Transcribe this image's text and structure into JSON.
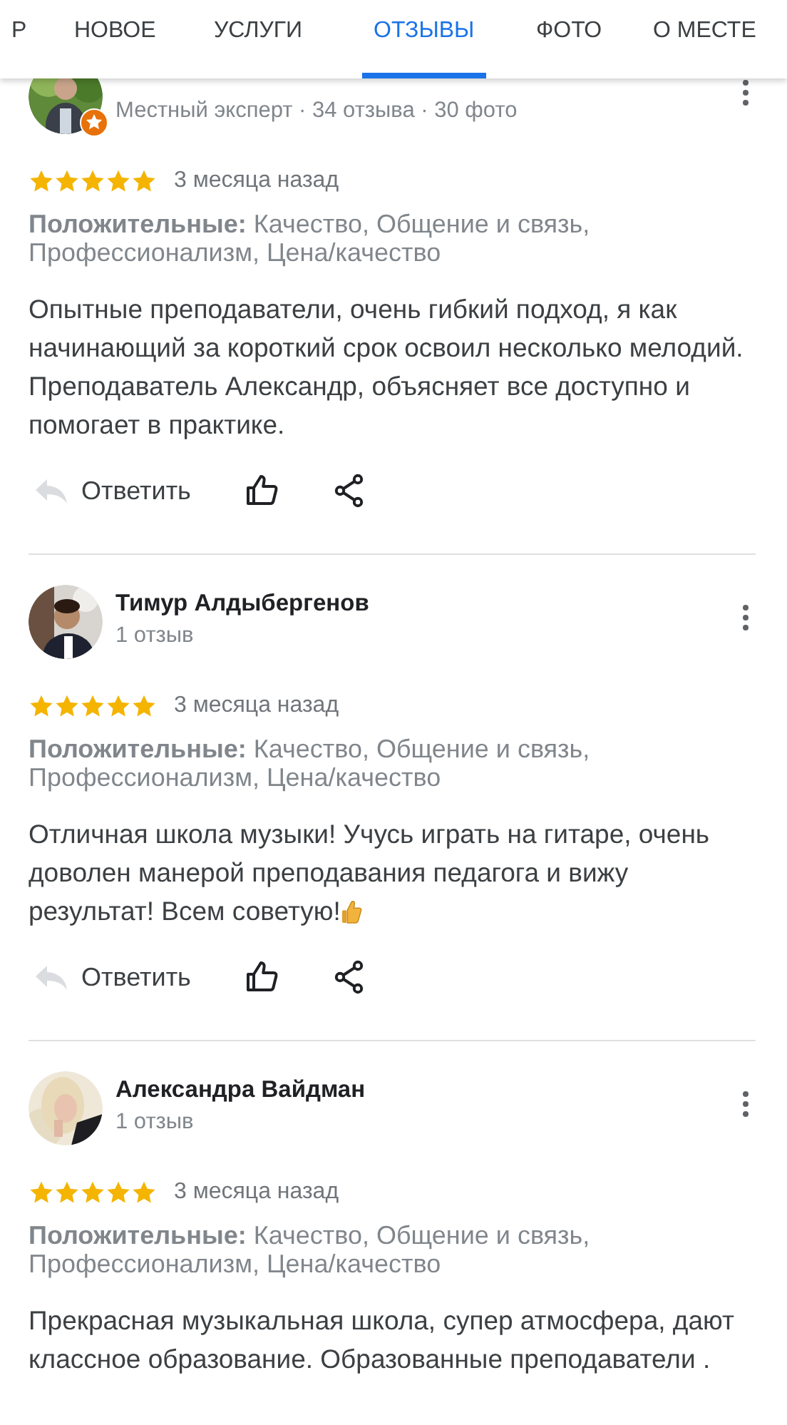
{
  "tabs": [
    {
      "label": "Р",
      "selected": false
    },
    {
      "label": "НОВОЕ",
      "selected": false
    },
    {
      "label": "УСЛУГИ",
      "selected": false
    },
    {
      "label": "ОТЗЫВЫ",
      "selected": true
    },
    {
      "label": "ФОТО",
      "selected": false
    },
    {
      "label": "О МЕСТЕ",
      "selected": false
    }
  ],
  "reviews": [
    {
      "meta": "Местный эксперт · 34 отзыва · 30 фото",
      "local_guide": true,
      "stars": 5,
      "date": "3 месяца назад",
      "positives": "**Положительные:** Качество, Общение и связь, Профессионализм, Цена/качество",
      "text": "Опытные преподаватели, очень гибкий подход, я как начинающий за короткий срок освоил несколько мелодий. Преподаватель Александр, объясняет все доступно и помогает в практике.",
      "ends_with_emoji": false,
      "reply_label": "Ответить"
    },
    {
      "author": "Тимур Алдыбергенов",
      "meta": "1 отзыв",
      "local_guide": false,
      "stars": 5,
      "date": "3 месяца назад",
      "positives": "**Положительные:** Качество, Общение и связь, Профессионализм, Цена/качество",
      "text": "Отличная школа музыки! Учусь играть на гитаре, очень доволен манерой преподавания педагога и вижу результат! Всем советую!",
      "ends_with_emoji": true,
      "reply_label": "Ответить"
    },
    {
      "author": "Александра Вайдман",
      "meta": "1 отзыв",
      "local_guide": false,
      "stars": 5,
      "date": "3 месяца назад",
      "positives": "**Положительные:** Качество, Общение и связь, Профессионализм, Цена/качество",
      "text": "Прекрасная музыкальная школа, супер атмосфера, дают классное образование. Образованные преподаватели .",
      "ends_with_emoji": false
    }
  ]
}
